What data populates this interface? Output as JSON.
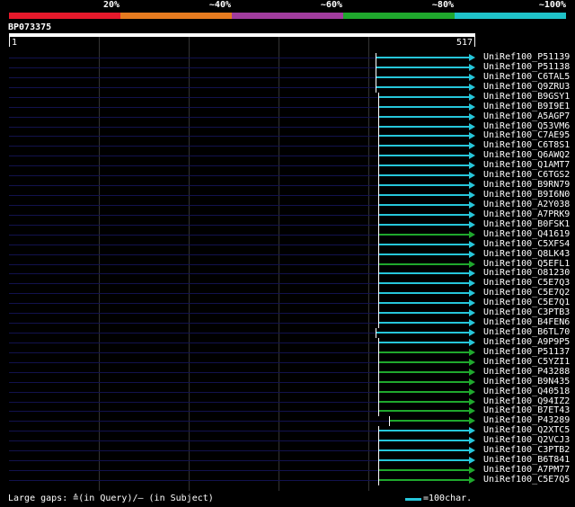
{
  "legend": {
    "colors": [
      "#e6192b",
      "#e67b1f",
      "#a13c9e",
      "#1fa82d",
      "#1fc2c8"
    ],
    "labels": [
      "20%",
      "~40%",
      "~60%",
      "~80%",
      "~100%"
    ]
  },
  "query": {
    "name": "BP073375",
    "start_label": "1",
    "end_label": "517"
  },
  "hits": [
    {
      "name": "UniRef100_P51139",
      "color": "#26c6da"
    },
    {
      "name": "UniRef100_P51138",
      "color": "#26c6da"
    },
    {
      "name": "UniRef100_C6TAL5",
      "color": "#26c6da"
    },
    {
      "name": "UniRef100_Q9ZRU3",
      "color": "#26c6da"
    },
    {
      "name": "UniRef100_B9GSY1",
      "color": "#26c6da"
    },
    {
      "name": "UniRef100_B9I9E1",
      "color": "#26c6da"
    },
    {
      "name": "UniRef100_A5AGP7",
      "color": "#26c6da"
    },
    {
      "name": "UniRef100_Q53VM6",
      "color": "#26c6da"
    },
    {
      "name": "UniRef100_C7AE95",
      "color": "#26c6da"
    },
    {
      "name": "UniRef100_C6T8S1",
      "color": "#26c6da"
    },
    {
      "name": "UniRef100_Q6AWQ2",
      "color": "#26c6da"
    },
    {
      "name": "UniRef100_Q1AMT7",
      "color": "#26c6da"
    },
    {
      "name": "UniRef100_C6TGS2",
      "color": "#26c6da"
    },
    {
      "name": "UniRef100_B9RN79",
      "color": "#26c6da"
    },
    {
      "name": "UniRef100_B9I6N0",
      "color": "#26c6da"
    },
    {
      "name": "UniRef100_A2Y038",
      "color": "#26c6da"
    },
    {
      "name": "UniRef100_A7PRK9",
      "color": "#26c6da"
    },
    {
      "name": "UniRef100_B0FSK1",
      "color": "#26c6da"
    },
    {
      "name": "UniRef100_Q41619",
      "color": "#1fa82d"
    },
    {
      "name": "UniRef100_C5XFS4",
      "color": "#26c6da"
    },
    {
      "name": "UniRef100_Q8LK43",
      "color": "#26c6da"
    },
    {
      "name": "UniRef100_Q5EFL1",
      "color": "#1fa82d"
    },
    {
      "name": "UniRef100_O81230",
      "color": "#26c6da"
    },
    {
      "name": "UniRef100_C5E7Q3",
      "color": "#26c6da"
    },
    {
      "name": "UniRef100_C5E7Q2",
      "color": "#26c6da"
    },
    {
      "name": "UniRef100_C5E7Q1",
      "color": "#26c6da"
    },
    {
      "name": "UniRef100_C3PTB3",
      "color": "#26c6da"
    },
    {
      "name": "UniRef100_B4FEN6",
      "color": "#26c6da"
    },
    {
      "name": "UniRef100_B6TL70",
      "color": "#26c6da"
    },
    {
      "name": "UniRef100_A9P9P5",
      "color": "#26c6da"
    },
    {
      "name": "UniRef100_P51137",
      "color": "#1fa82d"
    },
    {
      "name": "UniRef100_C5YZI1",
      "color": "#1fa82d"
    },
    {
      "name": "UniRef100_P43288",
      "color": "#1fa82d"
    },
    {
      "name": "UniRef100_B9N435",
      "color": "#1fa82d"
    },
    {
      "name": "UniRef100_Q40518",
      "color": "#1fa82d"
    },
    {
      "name": "UniRef100_Q94IZ2",
      "color": "#1fa82d"
    },
    {
      "name": "UniRef100_B7ET43",
      "color": "#1fa82d"
    },
    {
      "name": "UniRef100_P43289",
      "color": "#1fa82d"
    },
    {
      "name": "UniRef100_Q2XTC5",
      "color": "#26c6da"
    },
    {
      "name": "UniRef100_Q2VCJ3",
      "color": "#26c6da"
    },
    {
      "name": "UniRef100_C3PTB2",
      "color": "#26c6da"
    },
    {
      "name": "UniRef100_B6T841",
      "color": "#26c6da"
    },
    {
      "name": "UniRef100_A7PM77",
      "color": "#1fa82d"
    },
    {
      "name": "UniRef100_C5E7Q5",
      "color": "#1fa82d"
    }
  ],
  "footer": {
    "gaps_text": "Large gaps: ≙(in Query)/– (in Subject)",
    "scale_text": "=100char."
  }
}
